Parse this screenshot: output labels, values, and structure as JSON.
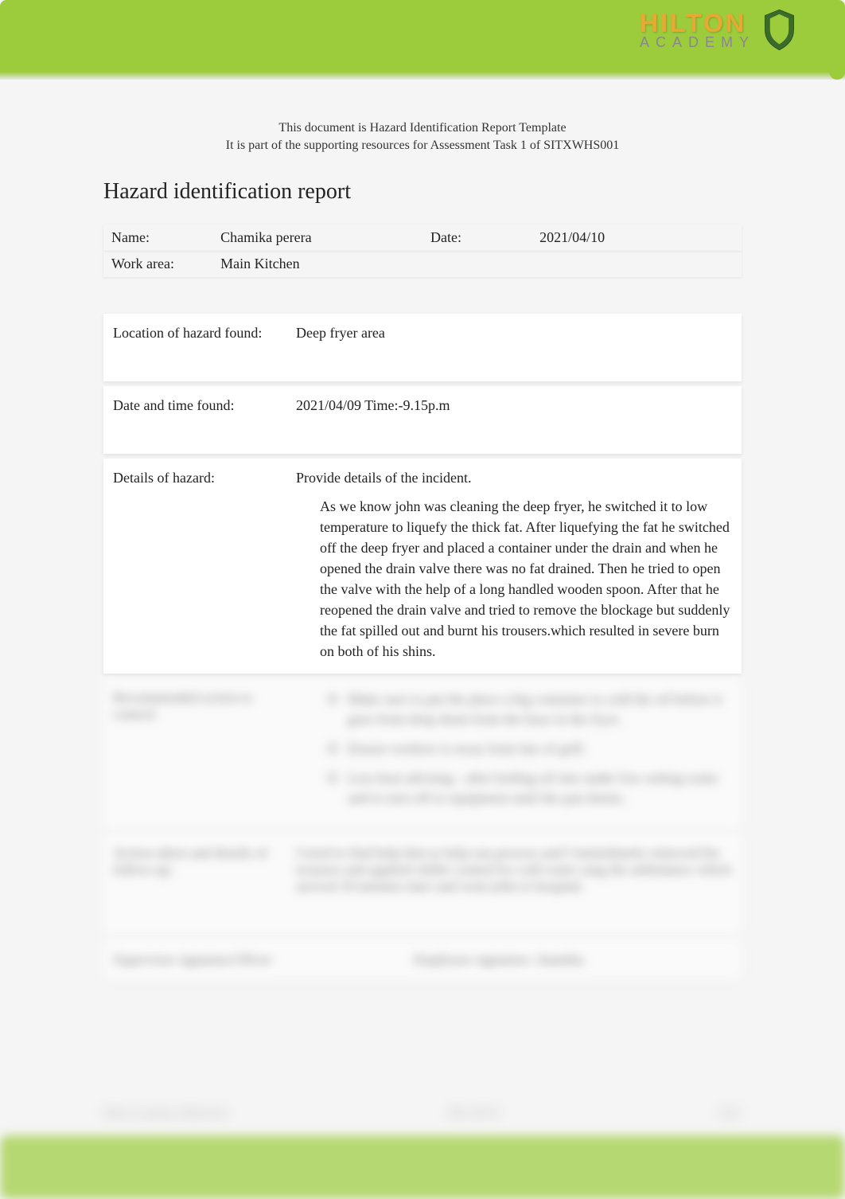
{
  "logo": {
    "text_top": "HILTON",
    "text_bottom": "ACADEMY"
  },
  "doc_meta": {
    "line1": "This document is Hazard Identification Report Template",
    "line2": "It is part of the supporting resources for Assessment Task 1 of SITXWHS001"
  },
  "title": "Hazard identification report",
  "info": {
    "name_label": "Name:",
    "name_value": "Chamika perera",
    "date_label": "Date:",
    "date_value": "2021/04/10",
    "workarea_label": "Work area:",
    "workarea_value": "Main Kitchen"
  },
  "hazard": {
    "location_label": "Location of hazard found:",
    "location_value": "Deep fryer area",
    "datetime_label": "Date and time found:",
    "datetime_value": "2021/04/09 Time:-9.15p.m",
    "details_label": "Details of hazard:",
    "details_intro": "Provide details of the incident.",
    "details_body": "As we know john was cleaning the deep fryer, he switched it to low temperature to liquefy the thick fat. After liquefying the fat he switched off the deep fryer and placed a container under the drain and when he opened the drain valve there was no fat drained. Then he tried to open the valve with the help of a long handled wooden spoon. After that he reopened the drain valve and tried to remove the blockage but suddenly the fat spilled out and burnt his trousers.which resulted in severe burn on both of his shins.",
    "recommended_label": "Recommended action to control:",
    "recommended_bullets": [
      "Make sure to put the place a big container to cold the oil before it goes from deep drain from the hose in the fryer.",
      "Ensure workers is away from fats of grill.",
      "Less heat advising - after boiling oil into under low setting water and to turn off to equipment until the pan drains."
    ],
    "action_label": "Action taken and details of follow-up:",
    "action_value": "I tried to find help him to help run process and I immediately removed his trousers and applied chiller waited for cold water rang the ambulance which arrived 10 minutes later and went john to hospital.",
    "supervisor_sig_label": "Supervisor signature:Oliver",
    "employee_sig_label": "Employee signature: chamika"
  },
  "footer": {
    "left": "Hilton Academy Melbourne",
    "center": "RTO 40735",
    "right": "2021"
  }
}
